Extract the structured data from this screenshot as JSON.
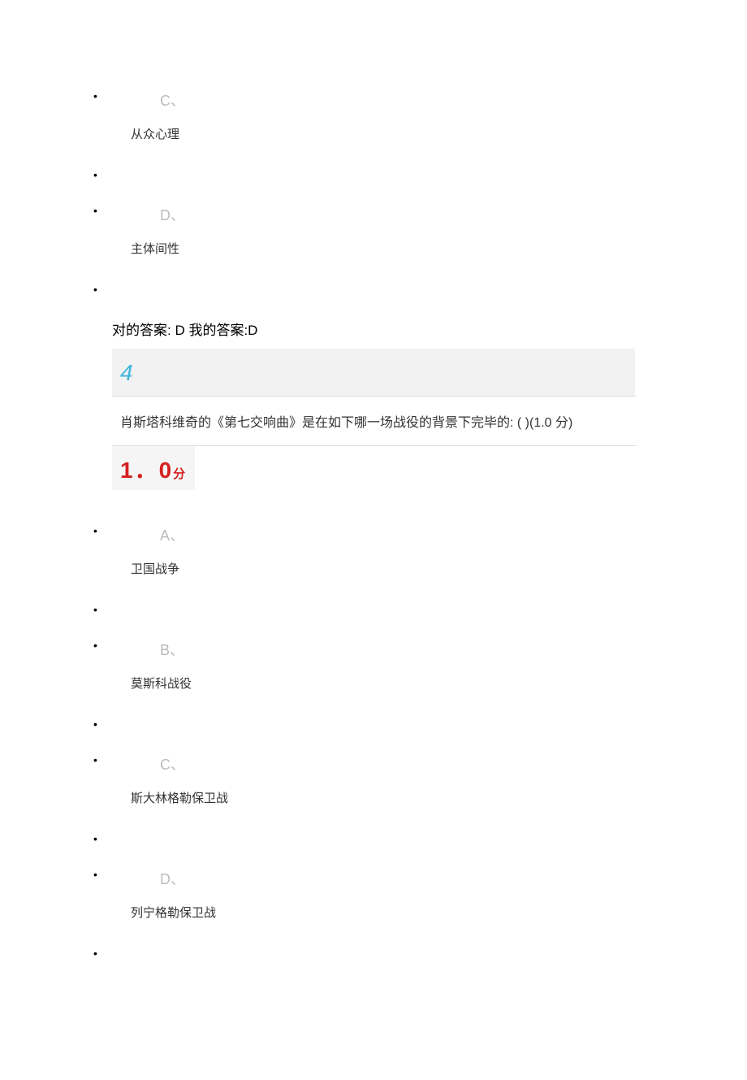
{
  "prev_question_tail": {
    "option_c": {
      "letter": "C、",
      "text": "从众心理"
    },
    "option_d": {
      "letter": "D、",
      "text": "主体间性"
    },
    "answer_line": "对的答案:  D  我的答案:D"
  },
  "question4": {
    "number": "4",
    "text": "肖斯塔科维奇的《第七交响曲》是在如下哪一场战役的背景下完毕的:  ( )(1.0 分)",
    "score_number": "1．0",
    "score_unit": "分",
    "options": {
      "a": {
        "letter": "A、",
        "text": "卫国战争"
      },
      "b": {
        "letter": "B、",
        "text": "莫斯科战役"
      },
      "c": {
        "letter": "C、",
        "text": "斯大林格勒保卫战"
      },
      "d": {
        "letter": "D、",
        "text": "列宁格勒保卫战"
      }
    }
  }
}
